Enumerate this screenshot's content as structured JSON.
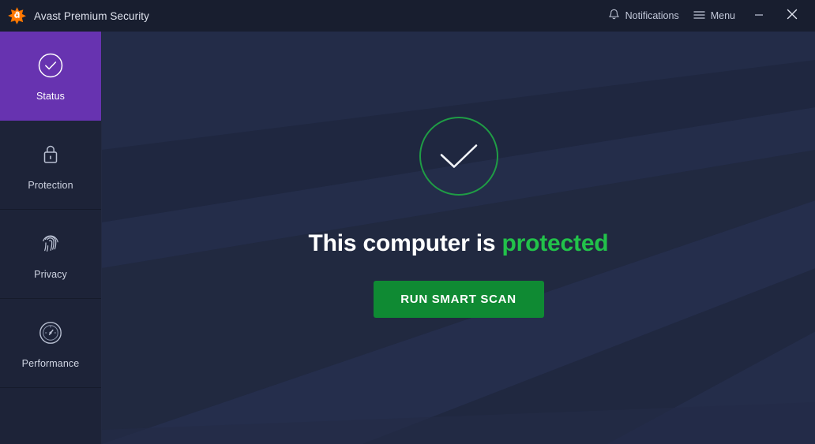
{
  "window": {
    "app_title": "Avast Premium Security",
    "logo_icon": "avast-logo-icon",
    "notifications_label": "Notifications",
    "notifications_icon": "bell-icon",
    "menu_label": "Menu",
    "menu_icon": "hamburger-menu-icon",
    "minimize_icon": "minimize-icon",
    "close_icon": "close-icon"
  },
  "sidebar": {
    "items": [
      {
        "label": "Status",
        "icon": "circle-check-icon",
        "active": true
      },
      {
        "label": "Protection",
        "icon": "lock-icon",
        "active": false
      },
      {
        "label": "Privacy",
        "icon": "fingerprint-icon",
        "active": false
      },
      {
        "label": "Performance",
        "icon": "speedometer-icon",
        "active": false
      }
    ],
    "active_color": "#6733b0"
  },
  "main": {
    "status_icon": "check-circle-large-icon",
    "headline_prefix": "This computer is",
    "headline_status": "protected",
    "scan_button_label": "RUN SMART SCAN",
    "accent_green": "#22c24a",
    "button_green": "#0f8a33",
    "background_color": "#222a44"
  }
}
